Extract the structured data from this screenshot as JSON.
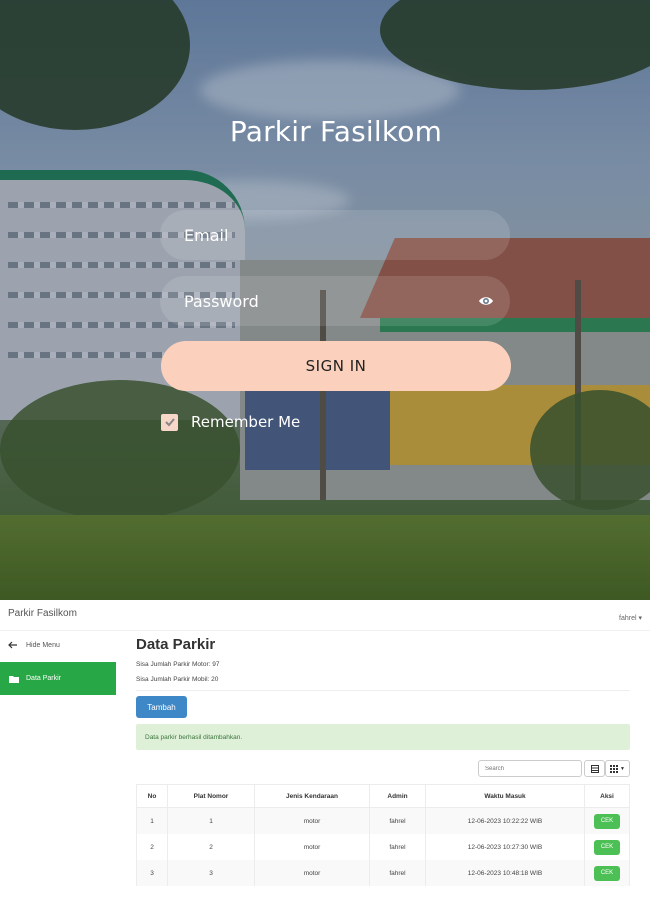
{
  "login": {
    "title": "Parkir Fasilkom",
    "email_placeholder": "Email",
    "password_placeholder": "Password",
    "signin_label": "SIGN IN",
    "remember_label": "Remember Me",
    "remember_checked": true
  },
  "dashboard": {
    "brand": "Parkir Fasilkom",
    "user": "fahrel ▾",
    "sidebar": {
      "hide_menu": "Hide Menu",
      "items": [
        {
          "label": "Data Parkir",
          "active": true
        }
      ]
    },
    "page_title": "Data Parkir",
    "sisa_motor": "Sisa Jumlah Parkir Motor: 97",
    "sisa_mobil": "Sisa Jumlah Parkir Mobil: 20",
    "tambah_label": "Tambah",
    "alert": "Data parkir berhasil ditambahkan.",
    "search_placeholder": "Search",
    "columns": [
      "No",
      "Plat Nomor",
      "Jenis Kendaraan",
      "Admin",
      "Waktu Masuk",
      "Aksi"
    ],
    "rows": [
      {
        "no": "1",
        "plat": "1",
        "jenis": "motor",
        "admin": "fahrel",
        "waktu": "12-06-2023 10:22:22 WIB",
        "aksi": "CEK"
      },
      {
        "no": "2",
        "plat": "2",
        "jenis": "motor",
        "admin": "fahrel",
        "waktu": "12-06-2023 10:27:30 WIB",
        "aksi": "CEK"
      },
      {
        "no": "3",
        "plat": "3",
        "jenis": "motor",
        "admin": "fahrel",
        "waktu": "12-06-2023 10:48:18 WIB",
        "aksi": "CEK"
      }
    ]
  },
  "colors": {
    "signin_bg": "#fbd1bd",
    "sidebar_active": "#27a745",
    "tambah_btn": "#3e88c8",
    "cek_btn": "#4cbf55",
    "alert_bg": "#dff0d8"
  }
}
